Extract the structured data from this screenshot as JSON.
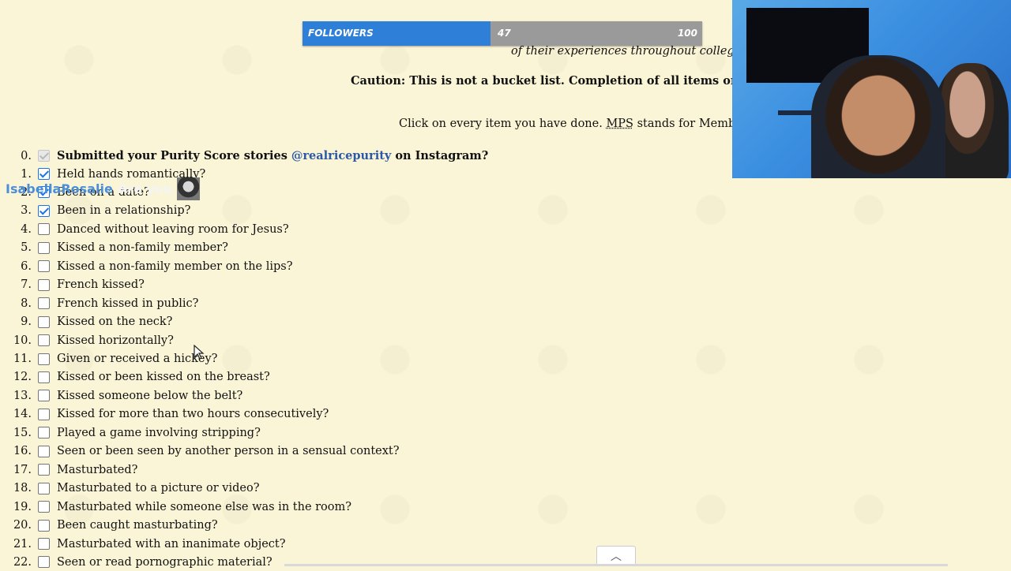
{
  "followers": {
    "label": "FOLLOWERS",
    "current": "47",
    "max": "100",
    "progress": 0.47
  },
  "intro": {
    "italic_line": "of their experiences throughout college.",
    "caution": "Caution: This is not a bucket list. Completion of all items on this tes",
    "instruction_pre": "Click on every item you have done. ",
    "instruction_mps": "MPS",
    "instruction_post": " stands for Member o"
  },
  "item0": {
    "num": "0.",
    "pre": "Submitted your Purity Score stories ",
    "handle": "@realricepurity",
    "post": " on Instagram?"
  },
  "items": [
    {
      "num": "1.",
      "text": "Held hands romantically?",
      "checked": true
    },
    {
      "num": "2.",
      "text": "Been on a date?",
      "checked": true
    },
    {
      "num": "3.",
      "text": "Been in a relationship?",
      "checked": true
    },
    {
      "num": "4.",
      "text": "Danced without leaving room for Jesus?",
      "checked": false
    },
    {
      "num": "5.",
      "text": "Kissed a non-family member?",
      "checked": false
    },
    {
      "num": "6.",
      "text": "Kissed a non-family member on the lips?",
      "checked": false
    },
    {
      "num": "7.",
      "text": "French kissed?",
      "checked": false
    },
    {
      "num": "8.",
      "text": "French kissed in public?",
      "checked": false
    },
    {
      "num": "9.",
      "text": "Kissed on the neck?",
      "checked": false
    },
    {
      "num": "10.",
      "text": "Kissed horizontally?",
      "checked": false
    },
    {
      "num": "11.",
      "text": "Given or received a hickey?",
      "checked": false
    },
    {
      "num": "12.",
      "text": "Kissed or been kissed on the breast?",
      "checked": false
    },
    {
      "num": "13.",
      "text": "Kissed someone below the belt?",
      "checked": false
    },
    {
      "num": "14.",
      "text": "Kissed for more than two hours consecutively?",
      "checked": false
    },
    {
      "num": "15.",
      "text": "Played a game involving stripping?",
      "checked": false
    },
    {
      "num": "16.",
      "text": "Seen or been seen by another person in a sensual context?",
      "checked": false
    },
    {
      "num": "17.",
      "text": "Masturbated?",
      "checked": false
    },
    {
      "num": "18.",
      "text": "Masturbated to a picture or video?",
      "checked": false
    },
    {
      "num": "19.",
      "text": "Masturbated while someone else was in the room?",
      "checked": false
    },
    {
      "num": "20.",
      "text": "Been caught masturbating?",
      "checked": false
    },
    {
      "num": "21.",
      "text": "Masturbated with an inanimate object?",
      "checked": false
    },
    {
      "num": "22.",
      "text": "Seen or read pornographic material?",
      "checked": false
    }
  ],
  "chat": {
    "user": "IsabellaRosalie",
    "message": "Are you"
  },
  "scroll_up_glyph": "︿"
}
